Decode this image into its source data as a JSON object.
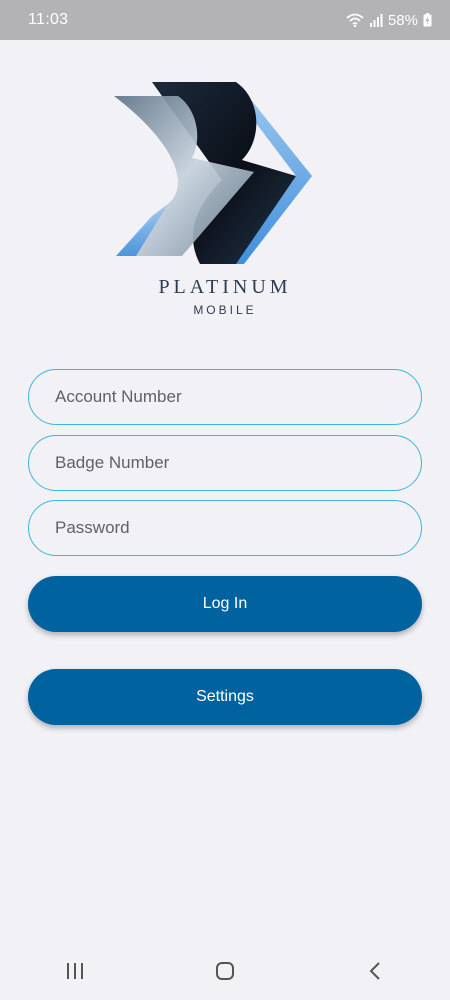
{
  "status_bar": {
    "time": "11:03",
    "battery_text": "58%"
  },
  "brand": {
    "name": "PLATINUM",
    "subtitle": "MOBILE"
  },
  "form": {
    "account_placeholder": "Account Number",
    "badge_placeholder": "Badge Number",
    "password_placeholder": "Password",
    "account_value": "",
    "badge_value": "",
    "password_value": ""
  },
  "buttons": {
    "login_label": "Log In",
    "settings_label": "Settings"
  },
  "nav": {
    "recents": "recents-icon",
    "home": "home-icon",
    "back": "back-icon"
  },
  "colors": {
    "accent": "#0063a0",
    "field_border": "#3bb6de",
    "background": "#f2f1f6"
  }
}
